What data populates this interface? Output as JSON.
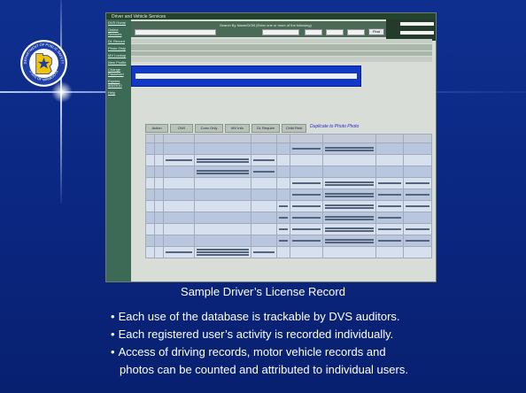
{
  "slide": {
    "caption": "Sample Driver’s License Record",
    "bullets": [
      "Each use of the database is trackable by DVS auditors.",
      "Each registered user’s activity is recorded individually.",
      "Access of driving records, motor vehicle records and",
      "photos can be counted and attributed to individual users."
    ],
    "bullet_glyph": "•"
  },
  "seal": {
    "top_text": "DEPARTMENT OF PUBLIC SAFETY",
    "bottom_text": "STATE OF MINNESOTA"
  },
  "colors": {
    "background": "#0a2680",
    "nav": "#3d6a56",
    "seal_gold": "#f2c400",
    "seal_blue": "#1e3ea8"
  },
  "screenshot": {
    "window_title": "Driver and Vehicle Services",
    "search_title": "Search By Name/DOB (Enter one or more of the following)",
    "find_button": "Find",
    "nav_items": [
      "DVS Home",
      "Online Services",
      "DL Record",
      "Photo Only",
      "MV Lookup",
      "New Profile",
      "Change Password",
      "Expires 8/5/2010",
      "Help",
      "Logout"
    ],
    "tabs": [
      "Action",
      "DWI",
      "Conv Only",
      "MV Info",
      "DL Require",
      "Child Rest"
    ],
    "dupe_link": "Duplicate to Photo Photo"
  }
}
